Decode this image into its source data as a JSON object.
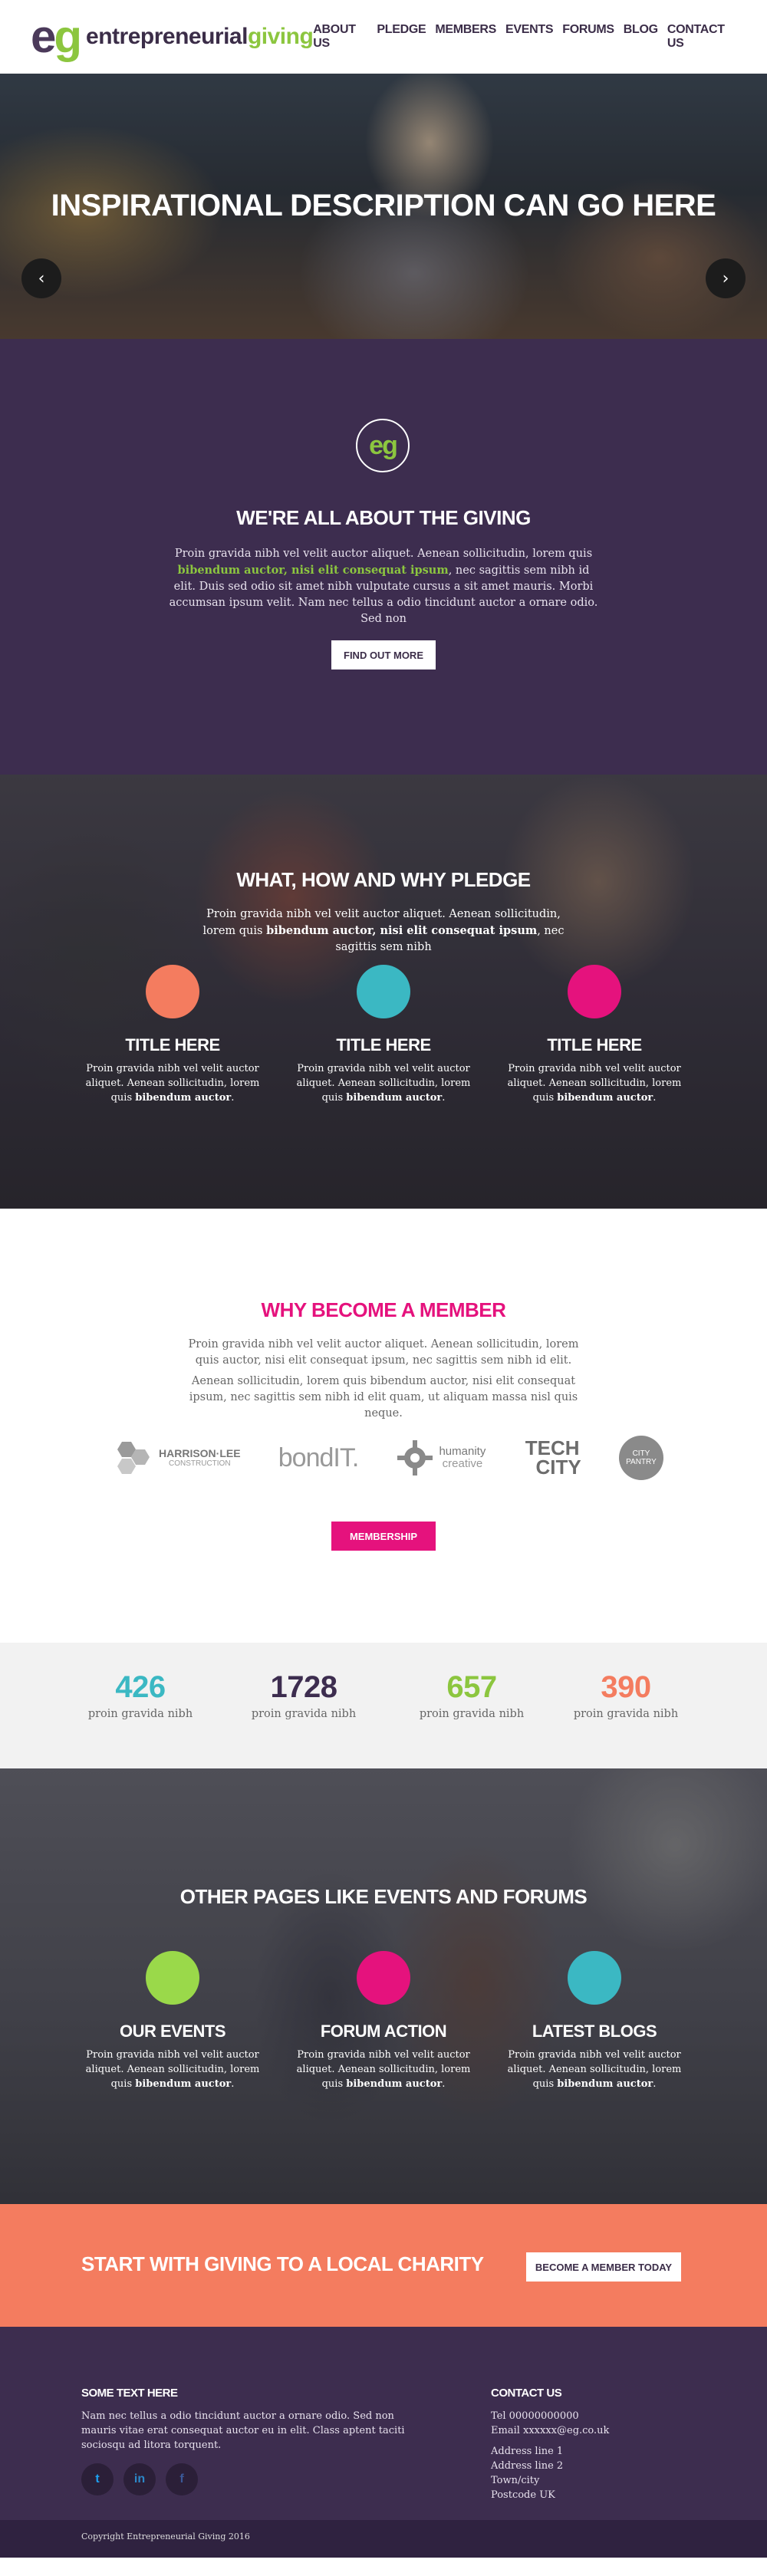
{
  "header": {
    "logo_mark_e": "e",
    "logo_mark_g": "g",
    "logo_text_a": "entrepreneurial",
    "logo_text_b": "giving",
    "nav": [
      "ABOUT US",
      "PLEDGE",
      "MEMBERS",
      "EVENTS",
      "FORUMS",
      "BLOG",
      "CONTACT US"
    ]
  },
  "hero": {
    "title": "INSPIRATIONAL DESCRIPTION CAN GO HERE",
    "prev_icon": "chevron-left-icon",
    "next_icon": "chevron-right-icon",
    "prev_glyph": "‹",
    "next_glyph": "›"
  },
  "about": {
    "badge": "eg",
    "title": "WE'RE ALL ABOUT THE GIVING",
    "text_1": "Proin gravida nibh vel velit auctor aliquet. Aenean sollicitudin, lorem quis ",
    "text_bold": "bibendum auctor, nisi elit consequat ipsum",
    "text_2": ", nec sagittis sem nibh id elit. Duis sed odio sit amet nibh vulputate cursus a sit amet mauris. Morbi accumsan ipsum velit. Nam nec tellus a odio tincidunt auctor a ornare odio. Sed non",
    "button": "FIND OUT MORE"
  },
  "pledge": {
    "title": "WHAT, HOW AND WHY PLEDGE",
    "lead_1": "Proin gravida nibh vel velit auctor aliquet. Aenean sollicitudin, lorem quis ",
    "lead_bold": "bibendum auctor, nisi elit consequat ipsum",
    "lead_2": ", nec sagittis sem nibh",
    "columns": [
      {
        "color": "#f47c5f",
        "title": "TITLE HERE",
        "text": "Proin gravida nibh vel velit auctor aliquet. Aenean sollicitudin, lorem quis ",
        "bold": "bibendum auctor",
        "end": "."
      },
      {
        "color": "#3bb8c3",
        "title": "TITLE HERE",
        "text": "Proin gravida nibh vel velit auctor aliquet. Aenean sollicitudin, lorem quis ",
        "bold": "bibendum auctor",
        "end": "."
      },
      {
        "color": "#e5127d",
        "title": "TITLE HERE",
        "text": "Proin gravida nibh vel velit auctor aliquet. Aenean sollicitudin, lorem quis ",
        "bold": "bibendum auctor",
        "end": "."
      }
    ]
  },
  "member": {
    "title": "WHY BECOME A MEMBER",
    "text_1": "Proin gravida nibh vel velit auctor aliquet. Aenean sollicitudin, lorem quis auctor, nisi elit consequat ipsum, nec sagittis sem nibh id elit.",
    "text_2": "Aenean sollicitudin, lorem quis bibendum auctor, nisi elit consequat ipsum, nec sagittis sem nibh id elit quam, ut aliquam massa nisl quis neque.",
    "logos": {
      "harrison_1": "HARRISON·LEE",
      "harrison_2": "CONSTRUCTION",
      "bondit": "bondIT.",
      "humanity_1": "humanity",
      "humanity_2": "creative",
      "tech_1": "TECH",
      "tech_2": "CITY",
      "pantry_1": "CITY",
      "pantry_2": "PANTRY"
    },
    "button": "MEMBERSHIP"
  },
  "stats": [
    {
      "num": "426",
      "label": "proin gravida nibh",
      "color": "#3bb8c3"
    },
    {
      "num": "1728",
      "label": "proin gravida nibh",
      "color": "#3d2d4f"
    },
    {
      "num": "657",
      "label": "proin gravida nibh",
      "color": "#8cc63f"
    },
    {
      "num": "390",
      "label": "proin gravida nibh",
      "color": "#f47c5f"
    }
  ],
  "other": {
    "title": "OTHER PAGES LIKE EVENTS AND FORUMS",
    "columns": [
      {
        "color": "#9ad94a",
        "title": "OUR EVENTS",
        "text": "Proin gravida nibh vel velit auctor aliquet. Aenean sollicitudin, lorem quis ",
        "bold": "bibendum auctor",
        "end": "."
      },
      {
        "color": "#e5127d",
        "title": "FORUM ACTION",
        "text": "Proin gravida nibh vel velit auctor aliquet. Aenean sollicitudin, lorem quis ",
        "bold": "bibendum auctor",
        "end": "."
      },
      {
        "color": "#3bb8c3",
        "title": "LATEST BLOGS",
        "text": "Proin gravida nibh vel velit auctor aliquet. Aenean sollicitudin, lorem quis ",
        "bold": "bibendum auctor",
        "end": "."
      }
    ]
  },
  "cta": {
    "title": "START WITH GIVING TO A LOCAL CHARITY",
    "button": "BECOME A MEMBER TODAY"
  },
  "footer": {
    "left_heading": "SOME TEXT HERE",
    "left_text": "Nam nec tellus a odio tincidunt auctor a ornare odio. Sed non  mauris vitae erat consequat auctor eu in elit. Class aptent taciti sociosqu ad litora torquent.",
    "social": [
      {
        "icon": "twitter-icon",
        "glyph": "t",
        "color": "#1da1f2"
      },
      {
        "icon": "linkedin-icon",
        "glyph": "in",
        "color": "#2c87c8"
      },
      {
        "icon": "facebook-icon",
        "glyph": "f",
        "color": "#3b5998"
      }
    ],
    "right_heading": "CONTACT US",
    "tel": "Tel 00000000000",
    "email": "Email xxxxxx@eg.co.uk",
    "address": [
      "Address line 1",
      "Address line 2",
      "Town/city",
      "Postcode UK"
    ],
    "copyright": "Copyright Entrepreneurial Giving 2016"
  }
}
